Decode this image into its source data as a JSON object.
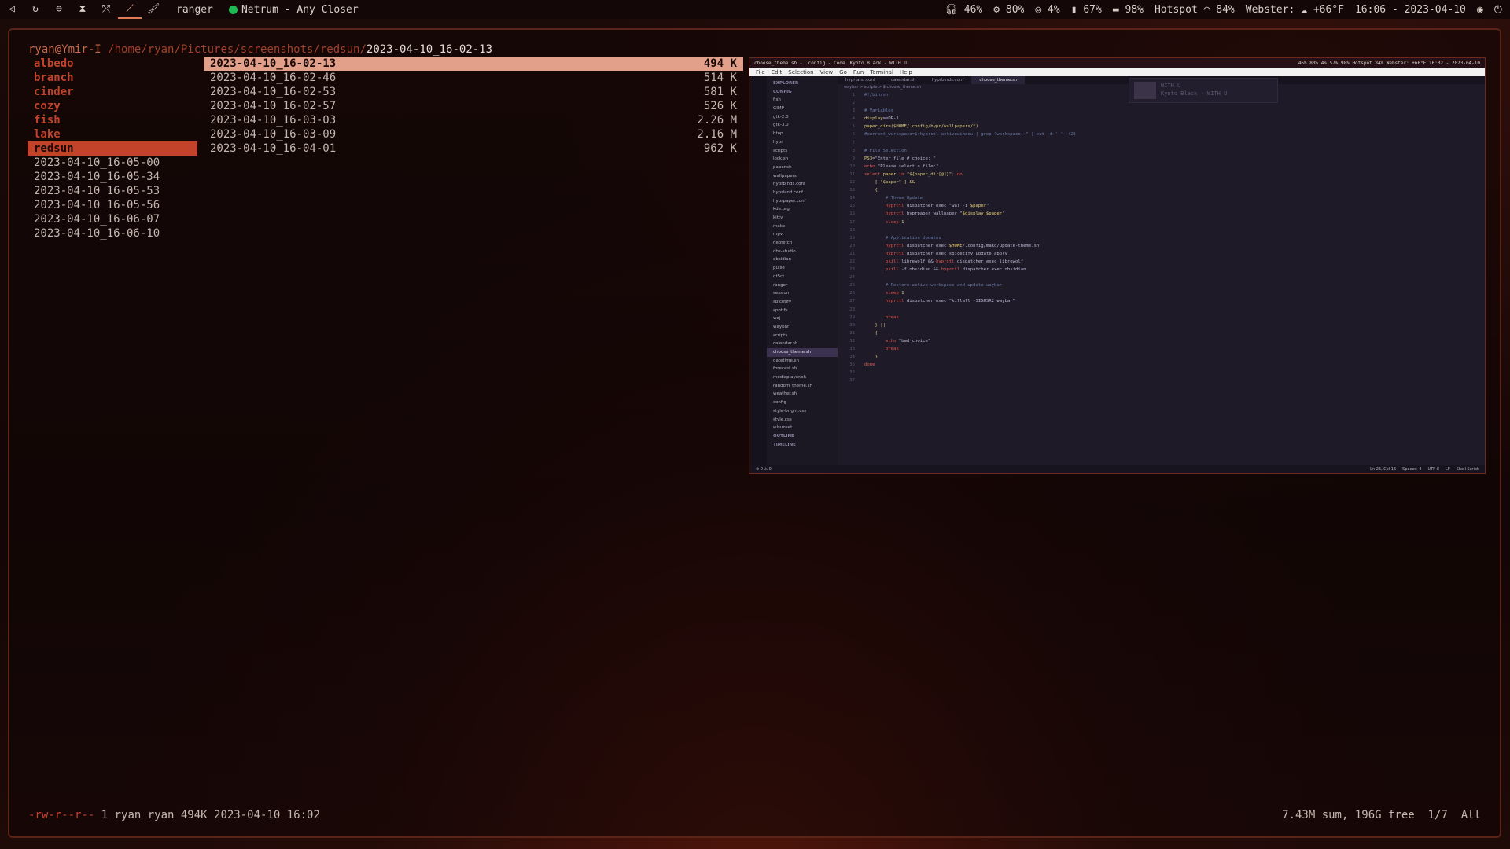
{
  "topbar": {
    "workspace_icons": [
      "arch-icon",
      "refresh-icon",
      "spotify-icon",
      "hourglass-icon",
      "tools-icon",
      "pen-icon",
      "brush-icon"
    ],
    "workspace_glyphs": [
      "◁",
      "↻",
      "⊜",
      "⧗",
      "⤲",
      "⟋",
      "🖌"
    ],
    "app": "ranger",
    "media": "Netrum - Any Closer",
    "headset": "46%",
    "cpu": "80%",
    "temp": "4%",
    "battery": "67%",
    "disk": "98%",
    "network": "Hotspot",
    "wifi": "84%",
    "weather": "Webster: ☁ +66°F",
    "clock": "16:06 - 2023-04-10"
  },
  "ranger": {
    "user_host": "ryan@Ymir-I",
    "dir": "/home/ryan/Pictures/screenshots/redsun/",
    "file": "2023-04-10_16-02-13",
    "parent_items": [
      {
        "name": "albedo",
        "type": "dir"
      },
      {
        "name": "branch",
        "type": "dir"
      },
      {
        "name": "cinder",
        "type": "dir"
      },
      {
        "name": "cozy",
        "type": "dir"
      },
      {
        "name": "fish",
        "type": "dir"
      },
      {
        "name": "lake",
        "type": "dir"
      },
      {
        "name": "redsun",
        "type": "dir",
        "selected": true
      },
      {
        "name": "2023-04-10_16-05-00",
        "type": "file"
      },
      {
        "name": "2023-04-10_16-05-34",
        "type": "file"
      },
      {
        "name": "2023-04-10_16-05-53",
        "type": "file"
      },
      {
        "name": "2023-04-10_16-05-56",
        "type": "file"
      },
      {
        "name": "2023-04-10_16-06-07",
        "type": "file"
      },
      {
        "name": "2023-04-10_16-06-10",
        "type": "file"
      }
    ],
    "files": [
      {
        "name": "2023-04-10_16-02-13",
        "size": "494 K",
        "selected": true
      },
      {
        "name": "2023-04-10_16-02-46",
        "size": "514 K"
      },
      {
        "name": "2023-04-10_16-02-53",
        "size": "581 K"
      },
      {
        "name": "2023-04-10_16-02-57",
        "size": "526 K"
      },
      {
        "name": "2023-04-10_16-03-03",
        "size": "2.26 M"
      },
      {
        "name": "2023-04-10_16-03-09",
        "size": "2.16 M"
      },
      {
        "name": "2023-04-10_16-04-01",
        "size": "962 K"
      }
    ],
    "status_perm": "-rw-r--r--",
    "status_info": " 1 ryan ryan 494K 2023-04-10 16:02",
    "status_right": "7.43M sum, 196G free  1/7  All"
  },
  "preview": {
    "topbar_left": "choose_theme.sh - .config - Code",
    "topbar_media": "Kyoto Black - WITH U",
    "topbar_right": "46%  80%  4%  57%  98%  Hotspot 84%  Webster: +66°F  16:02 - 2023-04-10",
    "menu": [
      "File",
      "Edit",
      "Selection",
      "View",
      "Go",
      "Run",
      "Terminal",
      "Help"
    ],
    "tabs": [
      "hyprland.conf",
      "calendar.sh",
      "hyprbinds.conf",
      "choose_theme.sh"
    ],
    "crumb": "waybar > scripts > $ choose_theme.sh",
    "popup": [
      "WITH U",
      "Kyoto Black - WITH U"
    ],
    "sidebar": [
      "EXPLORER",
      "CONFIG",
      "fish",
      "GIMP",
      "gtk-2.0",
      "gtk-3.0",
      "htop",
      "hypr",
      "scripts",
      "lock.sh",
      "paper.sh",
      "wallpapers",
      "hyprbinds.conf",
      "hyprland.conf",
      "hyprpaper.conf",
      "kde.org",
      "kitty",
      "mako",
      "mpv",
      "neofetch",
      "obs-studio",
      "obsidian",
      "pulse",
      "qt5ct",
      "ranger",
      "session",
      "spicetify",
      "spotify",
      "waj",
      "waybar",
      "scripts",
      "calendar.sh",
      "choose_theme.sh",
      "datetime.sh",
      "forecast.sh",
      "mediaplayer.sh",
      "random_theme.sh",
      "weather.sh",
      "config",
      "style-bright.css",
      "style.css",
      "wlsunset",
      "OUTLINE",
      "TIMELINE"
    ],
    "status_left": "⊗ 0 ⚠ 0",
    "status_right": [
      "Ln 26, Col 16",
      "Spaces: 4",
      "UTF-8",
      "LF",
      "Shell Script"
    ]
  }
}
